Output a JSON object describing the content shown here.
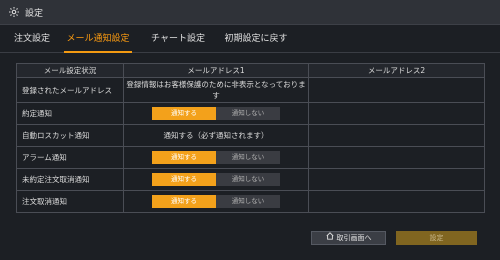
{
  "window": {
    "title": "設定",
    "icon": "gear-icon"
  },
  "tabs": [
    {
      "label": "注文設定"
    },
    {
      "label": "メール通知設定",
      "active": true
    },
    {
      "label": "チャート設定"
    },
    {
      "label": "初期設定に戻す"
    }
  ],
  "table": {
    "headers": [
      "メール設定状況",
      "メールアドレス1",
      "メールアドレス2"
    ],
    "registered": {
      "label": "登録されたメールアドレス",
      "note": "登録情報はお客様保護のために非表示となっております"
    },
    "auto_losscut": {
      "label": "自動ロスカット通知",
      "value": "通知する（必ず通知されます）"
    },
    "toggle_rows": [
      {
        "label": "約定通知",
        "on": "通知する",
        "off": "通知しない"
      },
      {
        "label": "アラーム通知",
        "on": "通知する",
        "off": "通知しない"
      },
      {
        "label": "未約定注文取消通知",
        "on": "通知する",
        "off": "通知しない"
      },
      {
        "label": "注文取消通知",
        "on": "通知する",
        "off": "通知しない"
      }
    ]
  },
  "buttons": {
    "home": "取引画面へ",
    "save": "設定"
  },
  "colors": {
    "accent": "#f39a12",
    "toggle_on": "#f3a11b",
    "save_disabled": "#806520"
  }
}
